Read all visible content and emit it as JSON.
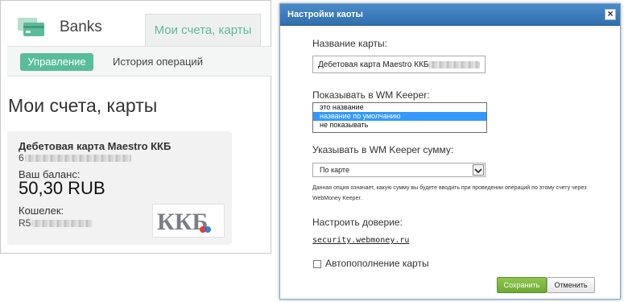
{
  "app": {
    "brand_name": "Banks",
    "top_tab": "Мои счета, карты",
    "subnav": {
      "manage": "Управление",
      "history": "История операций"
    },
    "page_title": "Мои счета, карты",
    "card": {
      "title": "Дебетовая карта Maestro ККБ",
      "number_prefix": "6",
      "balance_label": "Ваш баланс:",
      "balance_value": "50,30 RUB",
      "wallet_label": "Кошелек:",
      "wallet_prefix": "R5",
      "bank_logo_text": "ККБ"
    }
  },
  "dialog": {
    "title": "Настройки каоты",
    "close_label": "×",
    "name_label": "Название карты:",
    "name_value": "Дебетовая карта Maestro ККБ 6",
    "show_label": "Показывать в WM Keeper:",
    "show_options": [
      "это название",
      "название по умолчанию",
      "не показывать"
    ],
    "show_selected_index": 1,
    "sum_label": "Указывать в WM Keeper сумму:",
    "sum_value": "По карте",
    "note": "Данная опция означает, какую сумму вы будете вводить при проведении операций по этому счету через WebMoney Keeper.",
    "trust_label": "Настроить доверие:",
    "trust_link": "security.webmoney.ru",
    "autorefill_label": "Автопополнение карты",
    "save_label": "Сохранить",
    "cancel_label": "Отменить"
  },
  "colors": {
    "accent": "#59bd9c",
    "dialog_title": "#3a7cbc",
    "list_selected": "#3399ff",
    "save_button": "#7ab53f"
  }
}
